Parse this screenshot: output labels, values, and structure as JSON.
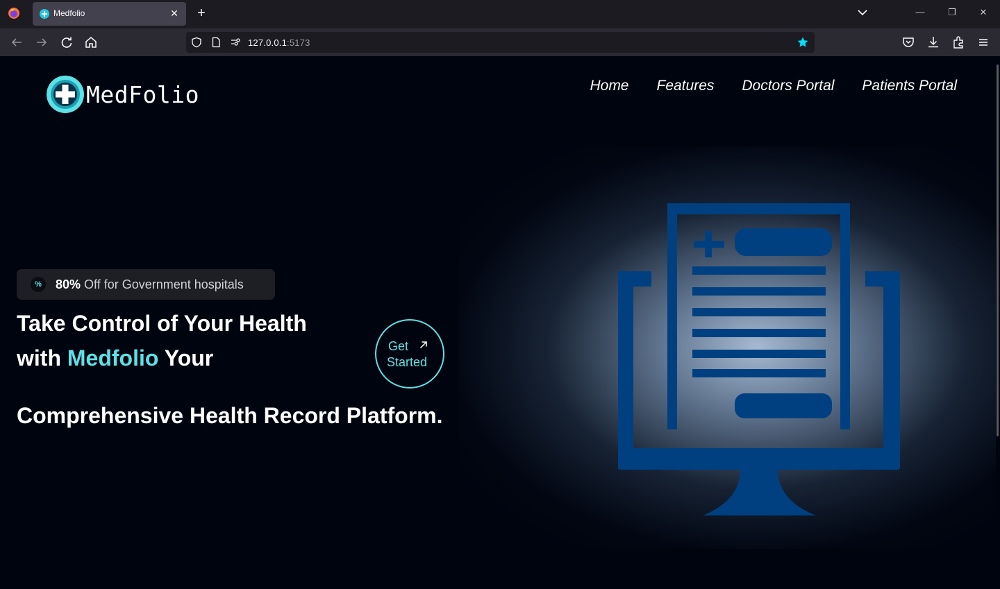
{
  "browser": {
    "tab_title": "Medfolio",
    "url_host": "127.0.0.1",
    "url_port": ":5173",
    "colors": {
      "tabbar": "#1c1b22",
      "toolbar": "#2b2a33",
      "active_tab": "#42414d",
      "bookmark_star": "#00ddff"
    },
    "icons": [
      "firefox-icon",
      "close-icon",
      "plus-icon",
      "chevron-down-icon",
      "minimize-icon",
      "restore-icon",
      "back-icon",
      "forward-icon",
      "reload-icon",
      "home-icon",
      "shield-icon",
      "page-icon",
      "connection-icon",
      "star-icon",
      "pocket-icon",
      "download-icon",
      "extensions-icon",
      "menu-icon"
    ]
  },
  "header": {
    "logo_text": "MedFolio",
    "nav": [
      "Home",
      "Features",
      "Doctors Portal",
      "Patients Portal"
    ]
  },
  "hero": {
    "badge_icon": "%",
    "badge_strong": "80%",
    "badge_text": " Off for Government hospitals",
    "title_line1": "Take Control of Your Health",
    "title_line2_pre": "with ",
    "title_line2_accent": "Medfolio",
    "title_line2_post": " Your",
    "title_line3": "Comprehensive Health Record Platform.",
    "cta_line1": "Get",
    "cta_line2": "Started"
  },
  "colors": {
    "page_bg": "#00040f",
    "accent": "#5ce1e6",
    "illustration": "#004080",
    "badge_bg": "#1e1f24"
  },
  "illustration": {
    "name": "medical-record-monitor-icon"
  }
}
